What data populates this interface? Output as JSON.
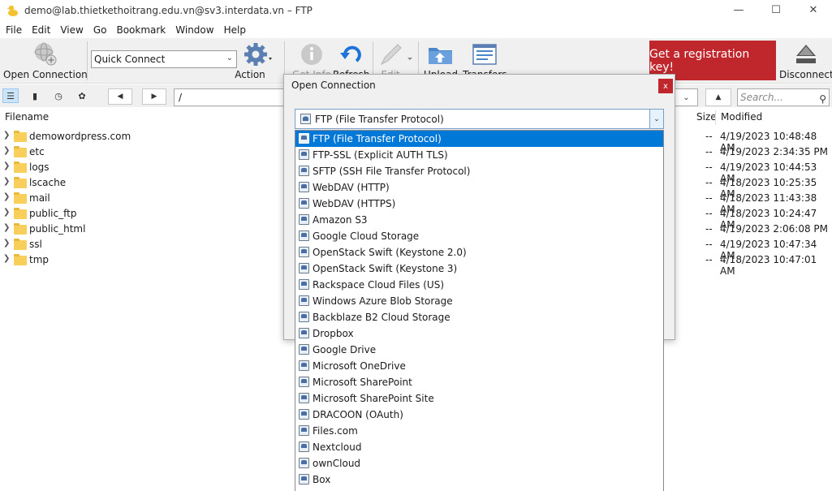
{
  "window": {
    "title": "demo@lab.thietkethoitrang.edu.vn@sv3.interdata.vn – FTP"
  },
  "menu": [
    "File",
    "Edit",
    "View",
    "Go",
    "Bookmark",
    "Window",
    "Help"
  ],
  "toolbar": {
    "open_connection": "Open Connection",
    "quick_connect": "Quick Connect",
    "action": "Action",
    "get_info": "Get Info",
    "refresh": "Refresh",
    "edit": "Edit",
    "upload": "Upload",
    "transfers": "Transfers",
    "registration": "Get a registration key!",
    "disconnect": "Disconnect"
  },
  "nav": {
    "path": "/",
    "search_placeholder": "Search..."
  },
  "columns": {
    "filename": "Filename",
    "size": "Size",
    "modified": "Modified"
  },
  "files": [
    {
      "name": "demowordpress.com",
      "size": "--",
      "modified": "4/19/2023 10:48:48 AM"
    },
    {
      "name": "etc",
      "size": "--",
      "modified": "4/19/2023 2:34:35 PM"
    },
    {
      "name": "logs",
      "size": "--",
      "modified": "4/19/2023 10:44:53 AM"
    },
    {
      "name": "lscache",
      "size": "--",
      "modified": "4/18/2023 10:25:35 AM"
    },
    {
      "name": "mail",
      "size": "--",
      "modified": "4/18/2023 11:43:38 AM"
    },
    {
      "name": "public_ftp",
      "size": "--",
      "modified": "4/18/2023 10:24:47 AM"
    },
    {
      "name": "public_html",
      "size": "--",
      "modified": "4/19/2023 2:06:08 PM"
    },
    {
      "name": "ssl",
      "size": "--",
      "modified": "4/19/2023 10:47:34 AM"
    },
    {
      "name": "tmp",
      "size": "--",
      "modified": "4/18/2023 10:47:01 AM"
    }
  ],
  "dialog": {
    "title": "Open Connection",
    "close": "x",
    "selected_protocol": "FTP (File Transfer Protocol)",
    "protocols": [
      "FTP (File Transfer Protocol)",
      "FTP-SSL (Explicit AUTH TLS)",
      "SFTP (SSH File Transfer Protocol)",
      "WebDAV (HTTP)",
      "WebDAV (HTTPS)",
      "Amazon S3",
      "Google Cloud Storage",
      "OpenStack Swift (Keystone 2.0)",
      "OpenStack Swift (Keystone 3)",
      "Rackspace Cloud Files (US)",
      "Windows Azure Blob Storage",
      "Backblaze B2 Cloud Storage",
      "Dropbox",
      "Google Drive",
      "Microsoft OneDrive",
      "Microsoft SharePoint",
      "Microsoft SharePoint Site",
      "DRACOON (OAuth)",
      "Files.com",
      "Nextcloud",
      "ownCloud",
      "Box"
    ]
  },
  "colors": {
    "accent": "#0078d7",
    "registration_bg": "#c0272d",
    "folder": "#f8cf5a"
  }
}
